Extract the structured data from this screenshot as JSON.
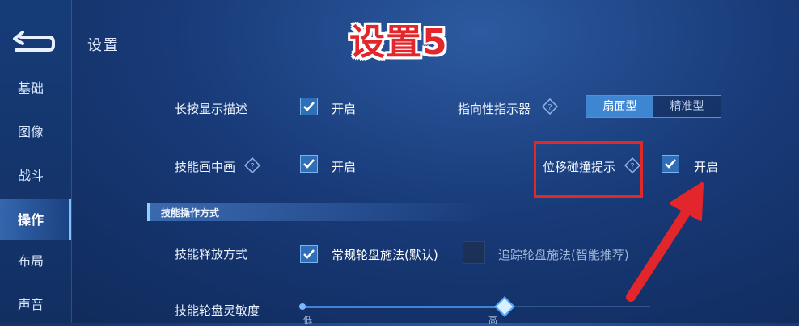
{
  "headline": "设置5",
  "page_title": "设置",
  "sidebar": {
    "items": [
      {
        "label": "基础"
      },
      {
        "label": "图像"
      },
      {
        "label": "战斗"
      },
      {
        "label": "操作"
      },
      {
        "label": "布局"
      },
      {
        "label": "声音"
      }
    ],
    "active": "操作"
  },
  "settings": {
    "long_press": {
      "label": "长按显示描述",
      "value": "开启",
      "checked": true
    },
    "directional": {
      "label": "指向性指示器",
      "options": [
        "扇面型",
        "精准型"
      ],
      "selected": "扇面型"
    },
    "skill_pip": {
      "label": "技能画中画",
      "value": "开启",
      "checked": true
    },
    "displacement": {
      "label": "位移碰撞提示",
      "value": "开启",
      "checked": true
    },
    "section_title": "技能操作方式",
    "release_mode": {
      "label": "技能释放方式",
      "option1": "常规轮盘施法(默认)",
      "option1_checked": true,
      "option2": "追踪轮盘施法(智能推荐)",
      "option2_checked": false
    },
    "sensitivity": {
      "label": "技能轮盘灵敏度",
      "low": "低",
      "high": "高",
      "level": 0.58
    }
  },
  "colors": {
    "accent": "#3f86d2",
    "annotation": "#e02a2a"
  }
}
